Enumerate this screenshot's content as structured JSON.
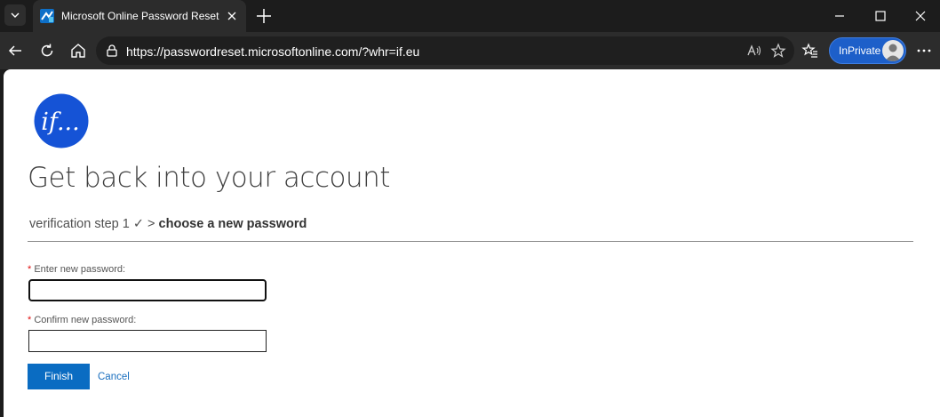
{
  "browser": {
    "tab_title": "Microsoft Online Password Reset",
    "url": "https://passwordreset.microsoftonline.com/?whr=if.eu",
    "inprivate_label": "InPrivate"
  },
  "logo": {
    "text": "if..."
  },
  "page": {
    "title": "Get back into your account",
    "breadcrumb": {
      "step_done": "verification step 1 ✓",
      "separator": ">",
      "current": "choose a new password"
    },
    "form": {
      "required_marker": "*",
      "new_password_label": "Enter new password:",
      "confirm_password_label": "Confirm new password:",
      "new_password_value": "",
      "confirm_password_value": ""
    },
    "actions": {
      "finish": "Finish",
      "cancel": "Cancel"
    }
  },
  "colors": {
    "accent": "#0a6cc2",
    "logo_blue": "#1553d6",
    "inprivate": "#1d5fc9",
    "required": "#e01010"
  }
}
